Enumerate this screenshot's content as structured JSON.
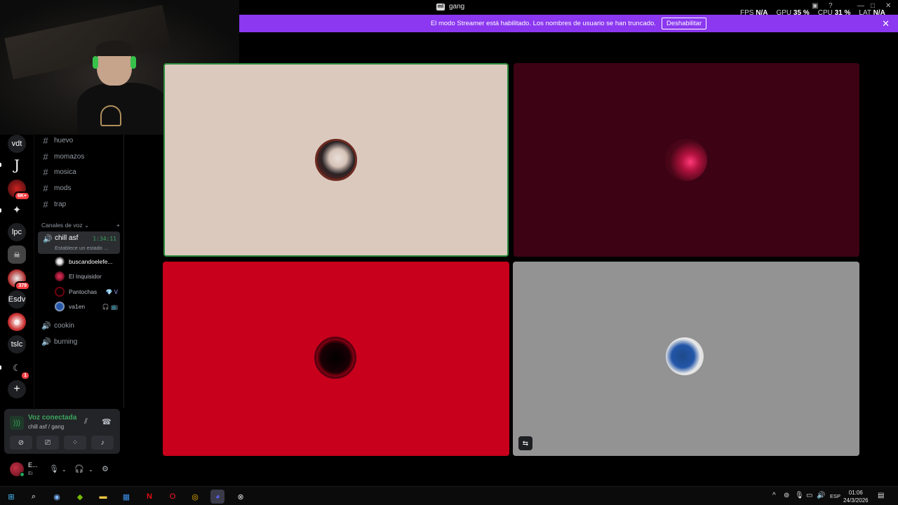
{
  "window": {
    "title": "gang",
    "logo_text": "ml",
    "stats": [
      {
        "label": "FPS",
        "value": "N/A"
      },
      {
        "label": "GPU",
        "value": "35 %"
      },
      {
        "label": "CPU",
        "value": "31 %"
      },
      {
        "label": "LAT",
        "value": "N/A"
      }
    ]
  },
  "banner": {
    "text": "El modo Streamer está habilitado. Los nombres de usuario se han truncado.",
    "button": "Deshabilitar",
    "close": "✕"
  },
  "servers": [
    {
      "label": "vdt"
    },
    {
      "label": "J"
    },
    {
      "label": "",
      "badge": "6K+"
    },
    {
      "label": ""
    },
    {
      "label": "lpc"
    },
    {
      "label": ""
    },
    {
      "label": "",
      "badge": "379"
    },
    {
      "label": "Esdv"
    },
    {
      "label": ""
    },
    {
      "label": "tslc"
    },
    {
      "label": "",
      "badge": "1"
    },
    {
      "label": "+"
    }
  ],
  "text_channels": [
    "huevo",
    "momazos",
    "mosica",
    "mods",
    "trap"
  ],
  "voice_category": {
    "label": "Canales de voz",
    "chevron": "⌄",
    "add": "+"
  },
  "active_voice": {
    "name": "chill asf",
    "time": "1:34:11",
    "status": "Establece un estado ..."
  },
  "members": [
    {
      "name": "buscandoelefe...",
      "color": "#dcd2c7"
    },
    {
      "name": "El Inquisidor",
      "color": "#9c0b20"
    },
    {
      "name": "Pantochas",
      "color": "#8a0012",
      "tag": "💎 V"
    },
    {
      "name": "va1en",
      "color": "#2356a8",
      "tag": "🎧 📺"
    }
  ],
  "other_voice_channels": [
    "cookin",
    "burning"
  ],
  "voice_panel": {
    "title": "Voz conectada",
    "subtitle": "chill asf / gang"
  },
  "user_panel": {
    "name": "E...",
    "subtitle": "Ei"
  },
  "taskbar": {
    "lang": "ESP",
    "time": "01:06",
    "date": "24/3/2026"
  },
  "colors": {
    "accent": "#8b38f0",
    "online": "#23a55a",
    "speaking": "#2c8a3c",
    "tile1": "#dbc9be",
    "tile2": "#3d0315",
    "tile3": "#c8001c",
    "tile4": "#939393"
  }
}
